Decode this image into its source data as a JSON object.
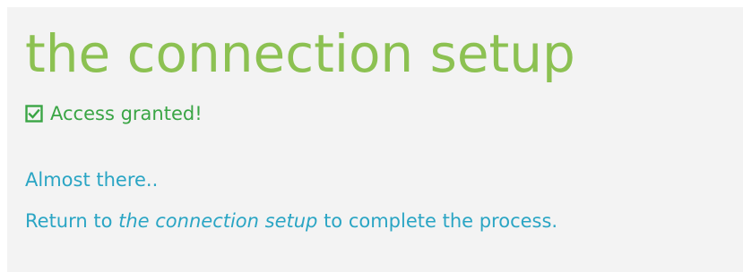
{
  "page": {
    "title": "the connection setup"
  },
  "status": {
    "icon": "checkbox-checked-icon",
    "text": "Access granted!",
    "color": "#3aa545"
  },
  "message": {
    "line1": "Almost there..",
    "line2_prefix": "Return to ",
    "line2_emphasis": "the connection setup",
    "line2_suffix": " to complete the process."
  },
  "colors": {
    "title": "#8cc152",
    "message": "#2aa5c4",
    "panel_background": "#f3f3f3"
  }
}
